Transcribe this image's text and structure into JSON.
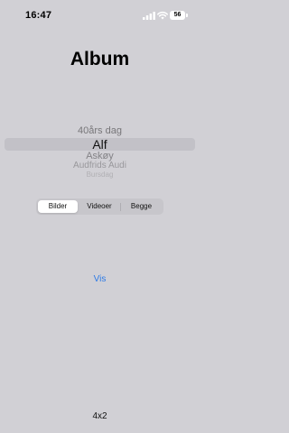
{
  "status_bar": {
    "time": "16:47",
    "battery": "56"
  },
  "header": {
    "title": "Album"
  },
  "picker": {
    "items": [
      "40års dag",
      "Alf",
      "Askøy",
      "Audfrids Audi",
      "Bursdag"
    ],
    "selected": "Alf"
  },
  "segmented_control": {
    "options": [
      "Bilder",
      "Videoer",
      "Begge"
    ],
    "selected": "Bilder"
  },
  "action": {
    "label": "Vis"
  },
  "footer": {
    "label": "4x2"
  },
  "colors": {
    "background": "#d1d0d5",
    "accent": "#2d7ae6"
  }
}
